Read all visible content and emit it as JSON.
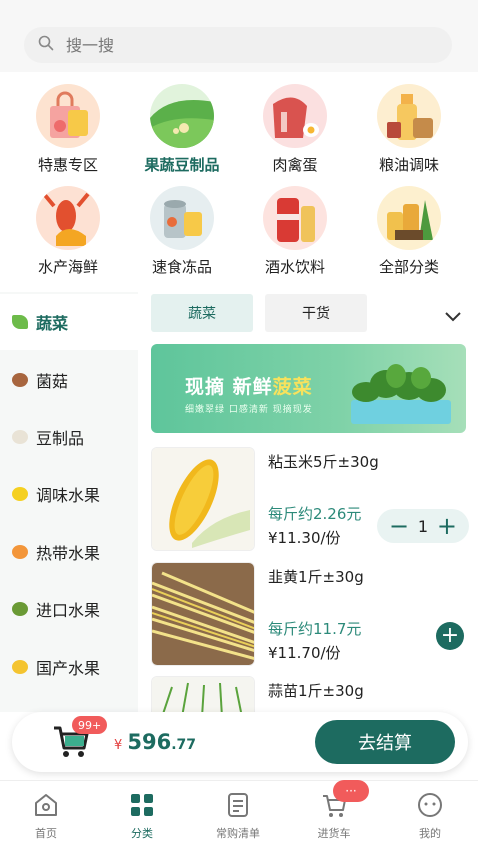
{
  "search": {
    "placeholder": "搜一搜"
  },
  "categories": [
    {
      "label": "特惠专区"
    },
    {
      "label": "果蔬豆制品"
    },
    {
      "label": "肉禽蛋"
    },
    {
      "label": "粮油调味"
    },
    {
      "label": "水产海鲜"
    },
    {
      "label": "速食冻品"
    },
    {
      "label": "酒水饮料"
    },
    {
      "label": "全部分类"
    }
  ],
  "sidebar": [
    {
      "label": "蔬菜",
      "active": true
    },
    {
      "label": "菌菇"
    },
    {
      "label": "豆制品"
    },
    {
      "label": "调味水果"
    },
    {
      "label": "热带水果"
    },
    {
      "label": "进口水果"
    },
    {
      "label": "国产水果"
    }
  ],
  "subtabs": [
    {
      "label": "蔬菜",
      "active": true
    },
    {
      "label": "干货"
    }
  ],
  "banner": {
    "title_a": "现摘 新鲜",
    "title_b": "菠菜",
    "subtitle": "细嫩翠绿  口感清新  现摘现发"
  },
  "products": [
    {
      "name": "粘玉米5斤±30g",
      "unit_price": "每斤约2.26元",
      "price": "¥11.30/份",
      "quantity": "1"
    },
    {
      "name": "韭黄1斤±30g",
      "unit_price": "每斤约11.7元",
      "price": "¥11.70/份"
    },
    {
      "name": "蒜苗1斤±30g"
    }
  ],
  "cart": {
    "badge": "99+",
    "currency": "¥",
    "total_int": "596",
    "total_dec": ".77",
    "checkout_label": "去结算"
  },
  "tabbar": [
    {
      "label": "首页"
    },
    {
      "label": "分类",
      "active": true
    },
    {
      "label": "常购清单"
    },
    {
      "label": "进货车"
    },
    {
      "label": "我的"
    }
  ],
  "message_badge": "···",
  "colors": {
    "accent": "#1d6b60",
    "price_green": "#2c8a7a",
    "badge_red": "#f15b5b",
    "side_bg": "#f6f8f7"
  }
}
